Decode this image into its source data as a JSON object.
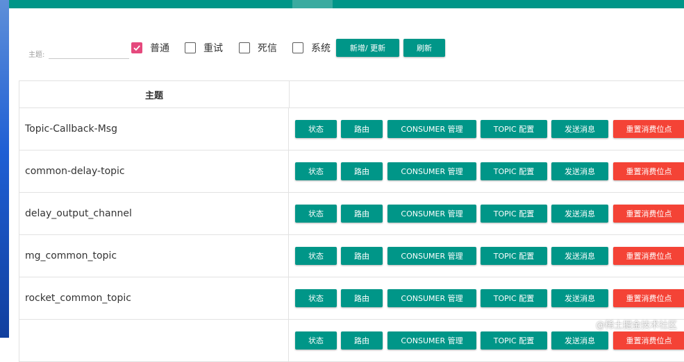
{
  "filter": {
    "topic_label": "主题:",
    "topic_value": "",
    "checkboxes": [
      {
        "label": "普通",
        "checked": true
      },
      {
        "label": "重试",
        "checked": false
      },
      {
        "label": "死信",
        "checked": false
      },
      {
        "label": "系统",
        "checked": false
      }
    ],
    "add_update_label": "新增/ 更新",
    "refresh_label": "刷新"
  },
  "table": {
    "header_topic": "主题",
    "row_actions": {
      "status": "状态",
      "route": "路由",
      "consumer": "CONSUMER 管理",
      "topic_config": "TOPIC 配置",
      "send": "发送消息",
      "reset": "重置消费位点"
    },
    "rows": [
      {
        "topic": "Topic-Callback-Msg"
      },
      {
        "topic": "common-delay-topic"
      },
      {
        "topic": "delay_output_channel"
      },
      {
        "topic": "mg_common_topic"
      },
      {
        "topic": "rocket_common_topic"
      },
      {
        "topic": ""
      }
    ]
  },
  "watermark": "@稀土掘金技术社区",
  "colors": {
    "accent": "#009688",
    "danger": "#f44336",
    "checkbox_checked": "#e5497d"
  }
}
